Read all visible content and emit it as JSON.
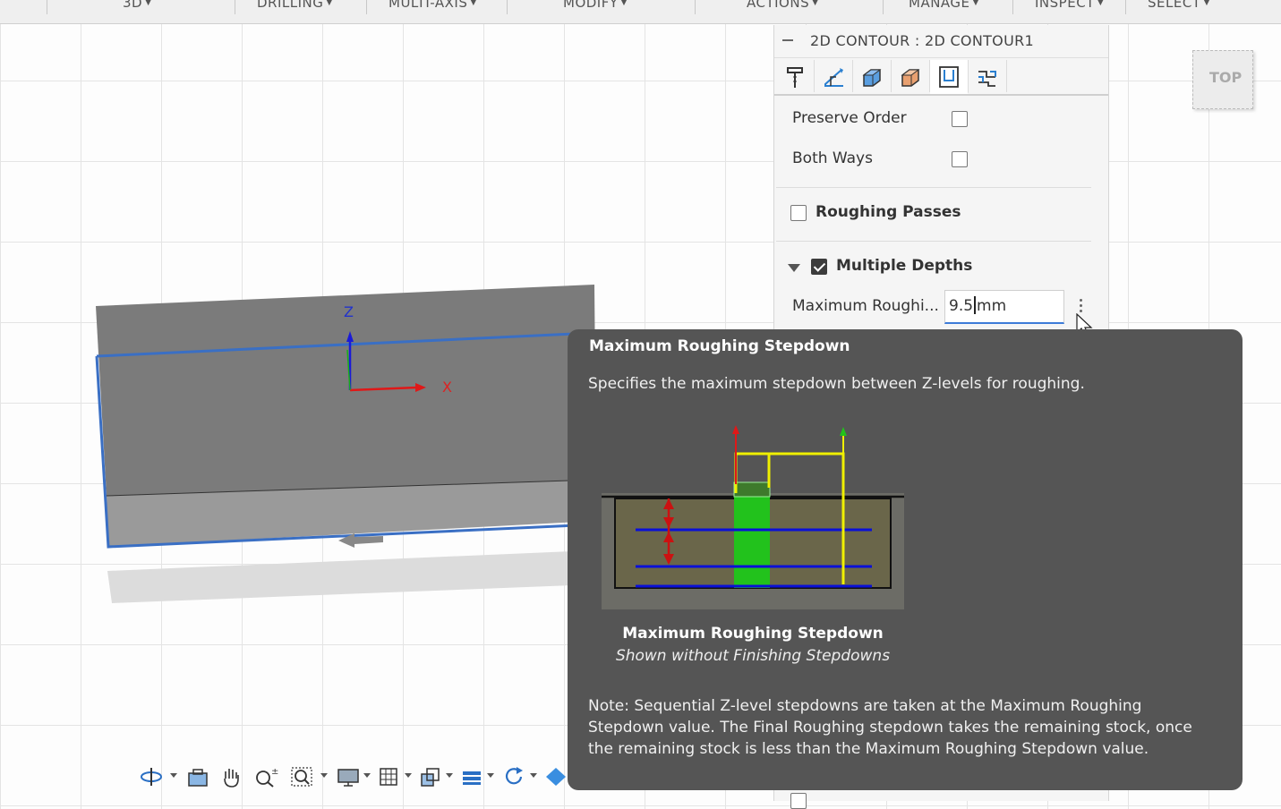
{
  "toolbar": {
    "menus": [
      "3D",
      "DRILLING",
      "MULTI-AXIS",
      "MODIFY",
      "ACTIONS",
      "MANAGE",
      "INSPECT",
      "SELECT"
    ]
  },
  "viewport": {
    "axis_z_label": "Z",
    "axis_x_label": "X",
    "viewcube_label": "TOP"
  },
  "panel": {
    "title": "2D CONTOUR : 2D CONTOUR1",
    "tabs": [
      "tool-icon",
      "geometry-icon",
      "heights-icon",
      "passes-icon",
      "linking-icon",
      "multiaxis-icon"
    ],
    "preserve_order_label": "Preserve Order",
    "preserve_order_checked": false,
    "both_ways_label": "Both Ways",
    "both_ways_checked": false,
    "roughing_passes_label": "Roughing Passes",
    "roughing_passes_checked": false,
    "multiple_depths_label": "Multiple Depths",
    "multiple_depths_checked": true,
    "max_roughing_label": "Maximum Roughi...",
    "max_roughing_value": "9.5",
    "max_roughing_unit": "mm"
  },
  "tooltip": {
    "title": "Maximum Roughing Stepdown",
    "description": "Specifies the maximum stepdown between Z-levels for roughing.",
    "caption_title": "Maximum Roughing Stepdown",
    "caption_subtitle": "Shown without Finishing Stepdowns",
    "note": "Note: Sequential Z-level stepdowns are taken at the Maximum Roughing Stepdown value. The Final Roughing stepdown takes the remaining stock, once the remaining stock is less than the Maximum Roughing Stepdown value."
  },
  "colors": {
    "accent": "#3c7bd8",
    "tooltip_bg": "#555555",
    "toolpath_green": "#22c21c",
    "depth_blue": "#0a10d8"
  },
  "bottom_toolbar": [
    "orbit-icon",
    "look-at-icon",
    "pan-icon",
    "zoom-icon",
    "zoom-window-icon",
    "display-settings-icon",
    "grid-icon",
    "view-cube-icon",
    "layers-icon",
    "refresh-icon",
    "effects-icon"
  ]
}
